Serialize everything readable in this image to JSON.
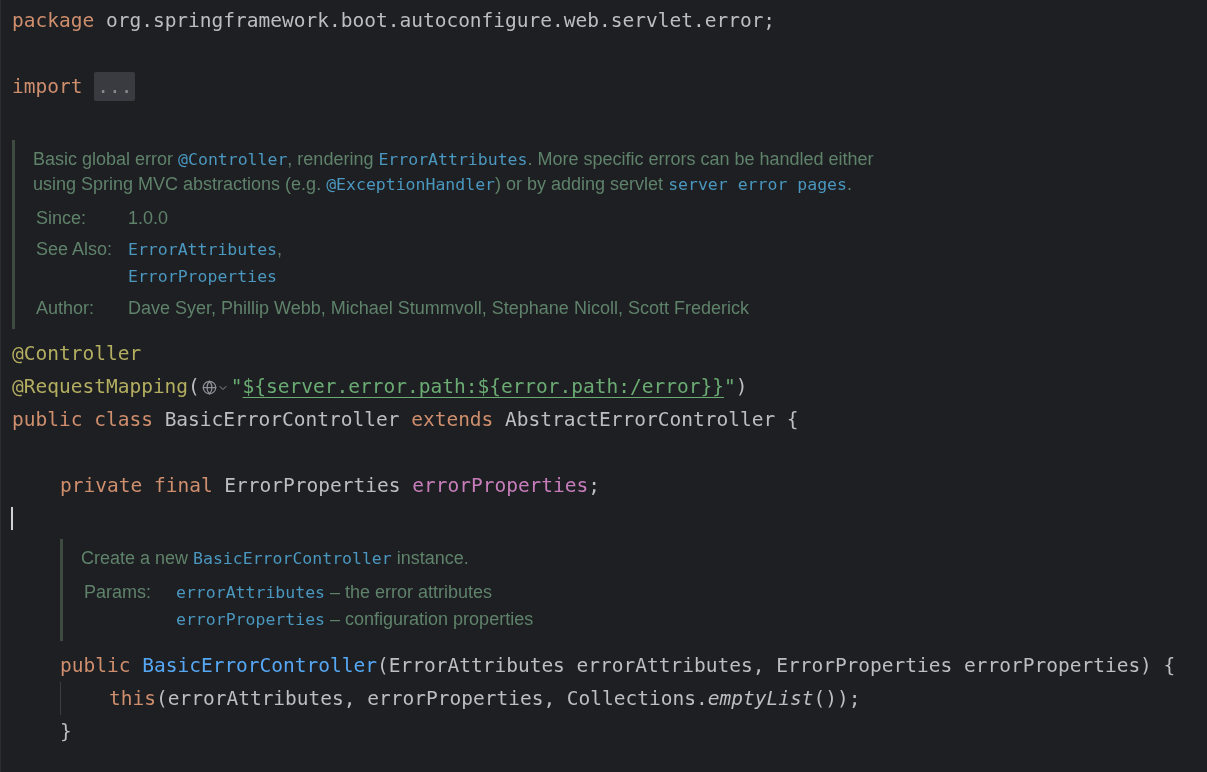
{
  "lines": [
    {
      "kind": "code",
      "tokens": [
        {
          "kind": "keyword",
          "text": "package"
        },
        {
          "kind": "plain",
          "text": " org.springframework.boot.autoconfigure.web.servlet.error;"
        }
      ]
    },
    {
      "kind": "blank"
    },
    {
      "kind": "code",
      "tokens": [
        {
          "kind": "keyword",
          "text": "import"
        },
        {
          "kind": "space"
        },
        {
          "kind": "fold",
          "text": "..."
        }
      ]
    },
    {
      "kind": "blank"
    },
    {
      "kind": "doc",
      "summary": [
        {
          "kind": "text",
          "text": "Basic global error "
        },
        {
          "kind": "code",
          "text": "@Controller"
        },
        {
          "kind": "text",
          "text": ", rendering "
        },
        {
          "kind": "code",
          "text": "ErrorAttributes"
        },
        {
          "kind": "text",
          "text": ". More specific errors can be handled either using Spring MVC abstractions (e.g. "
        },
        {
          "kind": "code",
          "text": "@ExceptionHandler"
        },
        {
          "kind": "text",
          "text": ") or by adding servlet "
        },
        {
          "kind": "code",
          "text": "server error pages"
        },
        {
          "kind": "text",
          "text": "."
        }
      ],
      "tags": [
        {
          "label": "Since:",
          "values": [
            [
              {
                "kind": "text",
                "text": "1.0.0"
              }
            ]
          ]
        },
        {
          "label": "See Also:",
          "values": [
            [
              {
                "kind": "code",
                "text": "ErrorAttributes"
              },
              {
                "kind": "text",
                "text": ","
              }
            ],
            [
              {
                "kind": "code",
                "text": "ErrorProperties"
              }
            ]
          ]
        },
        {
          "label": "Author:",
          "values": [
            [
              {
                "kind": "text",
                "text": "Dave Syer, Phillip Webb, Michael Stummvoll, Stephane Nicoll, Scott Frederick"
              }
            ]
          ]
        }
      ]
    },
    {
      "kind": "code",
      "tokens": [
        {
          "kind": "annotation",
          "text": "@Controller"
        }
      ]
    },
    {
      "kind": "code",
      "tokens": [
        {
          "kind": "annotation",
          "text": "@RequestMapping"
        },
        {
          "kind": "plain",
          "text": "("
        },
        {
          "kind": "inlay"
        },
        {
          "kind": "string",
          "text": "\""
        },
        {
          "kind": "link",
          "text": "${server.error.path:${error.path:/error}}"
        },
        {
          "kind": "string",
          "text": "\""
        },
        {
          "kind": "plain",
          "text": ")"
        }
      ]
    },
    {
      "kind": "code",
      "tokens": [
        {
          "kind": "keyword",
          "text": "public class"
        },
        {
          "kind": "plain",
          "text": " BasicErrorController "
        },
        {
          "kind": "keyword",
          "text": "extends"
        },
        {
          "kind": "plain",
          "text": " AbstractErrorController {"
        }
      ],
      "children": [
        {
          "kind": "blank"
        },
        {
          "kind": "code",
          "tokens": [
            {
              "kind": "keyword",
              "text": "private final"
            },
            {
              "kind": "plain",
              "text": " ErrorProperties "
            },
            {
              "kind": "field",
              "text": "errorProperties"
            },
            {
              "kind": "plain",
              "text": ";"
            }
          ]
        },
        {
          "kind": "blank",
          "caret": true
        },
        {
          "kind": "doc",
          "summary": [
            {
              "kind": "text",
              "text": "Create a new "
            },
            {
              "kind": "code",
              "text": "BasicErrorController"
            },
            {
              "kind": "text",
              "text": " instance."
            }
          ],
          "tags": [
            {
              "label": "Params:",
              "values": [
                [
                  {
                    "kind": "code",
                    "text": "errorAttributes"
                  },
                  {
                    "kind": "text",
                    "text": " – the error attributes"
                  }
                ],
                [
                  {
                    "kind": "code",
                    "text": "errorProperties"
                  },
                  {
                    "kind": "text",
                    "text": " – configuration properties"
                  }
                ]
              ]
            }
          ]
        },
        {
          "kind": "code",
          "tokens": [
            {
              "kind": "keyword",
              "text": "public"
            },
            {
              "kind": "space"
            },
            {
              "kind": "method",
              "text": "BasicErrorController"
            },
            {
              "kind": "plain",
              "text": "(ErrorAttributes errorAttributes, ErrorProperties errorProperties) {"
            }
          ],
          "children": [
            {
              "kind": "code",
              "tokens": [
                {
                  "kind": "keyword",
                  "text": "this"
                },
                {
                  "kind": "plain",
                  "text": "(errorAttributes, errorProperties, Collections."
                },
                {
                  "kind": "call",
                  "text": "emptyList"
                },
                {
                  "kind": "plain",
                  "text": "());"
                }
              ]
            }
          ]
        },
        {
          "kind": "code",
          "tokens": [
            {
              "kind": "plain",
              "text": "}"
            }
          ]
        }
      ]
    }
  ]
}
